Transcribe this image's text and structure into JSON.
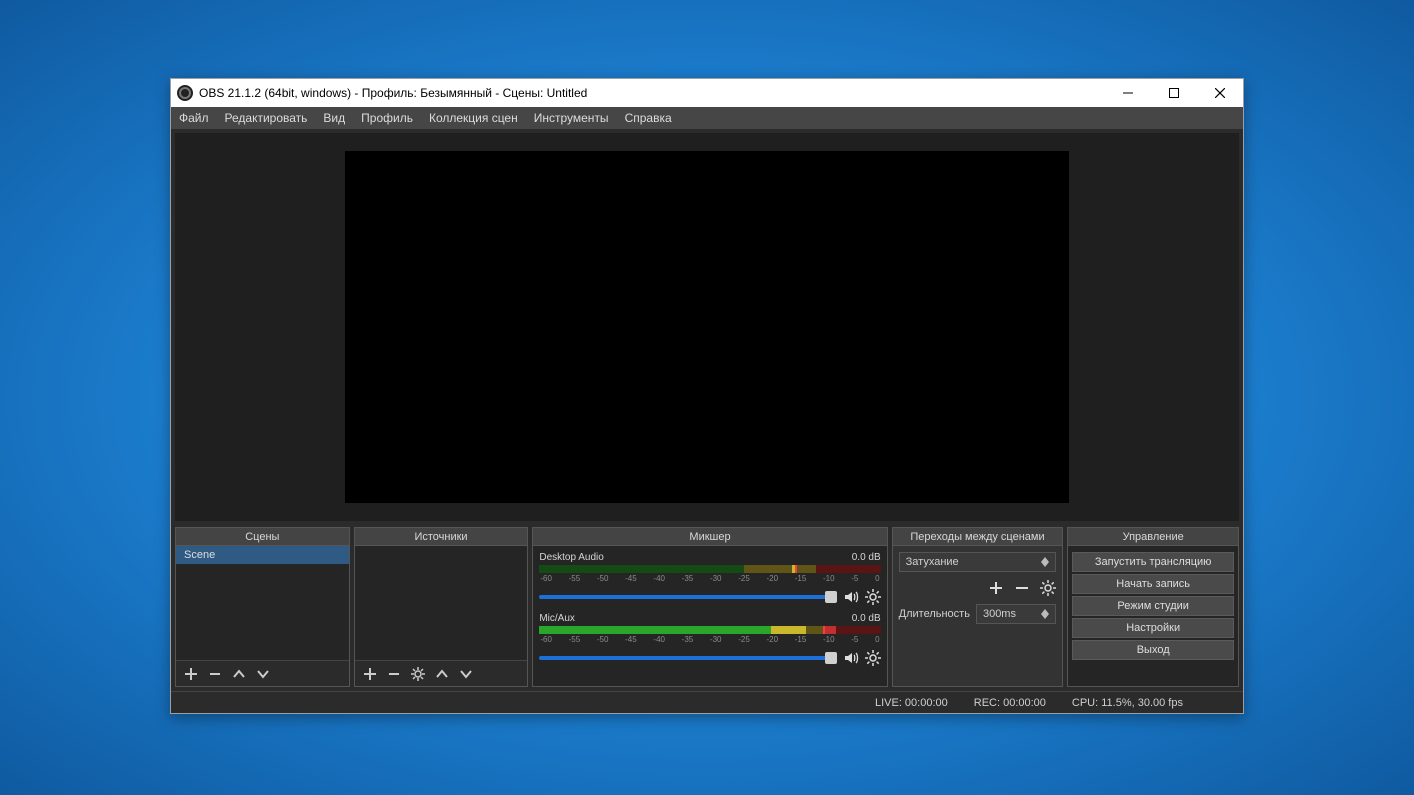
{
  "window": {
    "title": "OBS 21.1.2 (64bit, windows) - Профиль: Безымянный - Сцены: Untitled"
  },
  "menu": [
    "Файл",
    "Редактировать",
    "Вид",
    "Профиль",
    "Коллекция сцен",
    "Инструменты",
    "Справка"
  ],
  "docks": {
    "scenes": {
      "title": "Сцены",
      "items": [
        "Scene"
      ]
    },
    "sources": {
      "title": "Источники"
    },
    "mixer": {
      "title": "Микшер",
      "channels": [
        {
          "name": "Desktop Audio",
          "db": "0.0 dB"
        },
        {
          "name": "Mic/Aux",
          "db": "0.0 dB"
        }
      ],
      "scale": [
        "-60",
        "-55",
        "-50",
        "-45",
        "-40",
        "-35",
        "-30",
        "-25",
        "-20",
        "-15",
        "-10",
        "-5",
        "0"
      ]
    },
    "transitions": {
      "title": "Переходы между сценами",
      "selected": "Затухание",
      "duration_label": "Длительность",
      "duration_value": "300ms"
    },
    "controls": {
      "title": "Управление",
      "buttons": [
        "Запустить трансляцию",
        "Начать запись",
        "Режим студии",
        "Настройки",
        "Выход"
      ]
    }
  },
  "status": {
    "live": "LIVE: 00:00:00",
    "rec": "REC: 00:00:00",
    "cpu": "CPU: 11.5%, 30.00 fps"
  }
}
